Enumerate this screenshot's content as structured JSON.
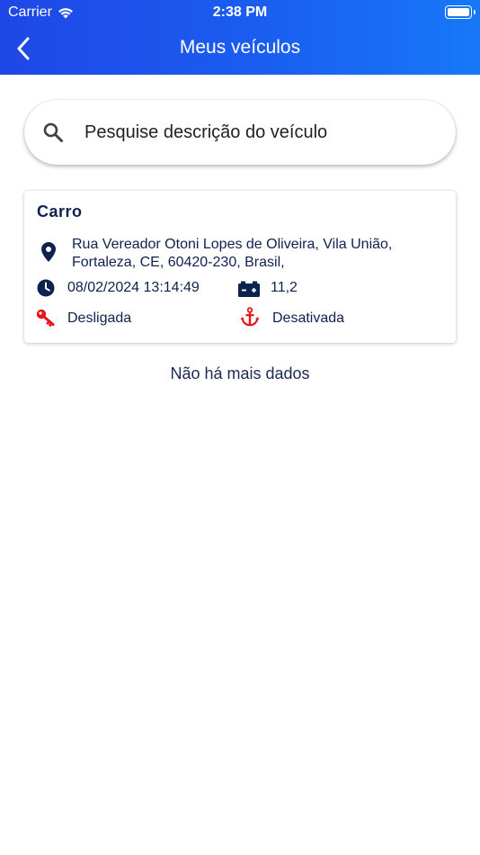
{
  "status_bar": {
    "carrier": "Carrier",
    "time": "2:38 PM"
  },
  "nav": {
    "title": "Meus veículos"
  },
  "search": {
    "placeholder": "Pesquise descrição do veículo"
  },
  "vehicles": [
    {
      "name": "Carro",
      "address_line1": "Rua Vereador Otoni Lopes de Oliveira, Vila União,",
      "address_line2": "Fortaleza, CE, 60420-230, Brasil,",
      "datetime": "08/02/2024 13:14:49",
      "battery": "11,2",
      "ignition": "Desligada",
      "anchor": "Desativada"
    }
  ],
  "footer": {
    "no_more": "Não há mais dados"
  },
  "colors": {
    "header_start": "#1f47e6",
    "header_end": "#1778f7",
    "text_dark": "#0e2250",
    "alert_red": "#e8151b"
  },
  "icons": [
    "wifi-icon",
    "back-chevron-icon",
    "search-icon",
    "location-pin-icon",
    "clock-icon",
    "battery-icon",
    "key-icon",
    "anchor-icon"
  ]
}
